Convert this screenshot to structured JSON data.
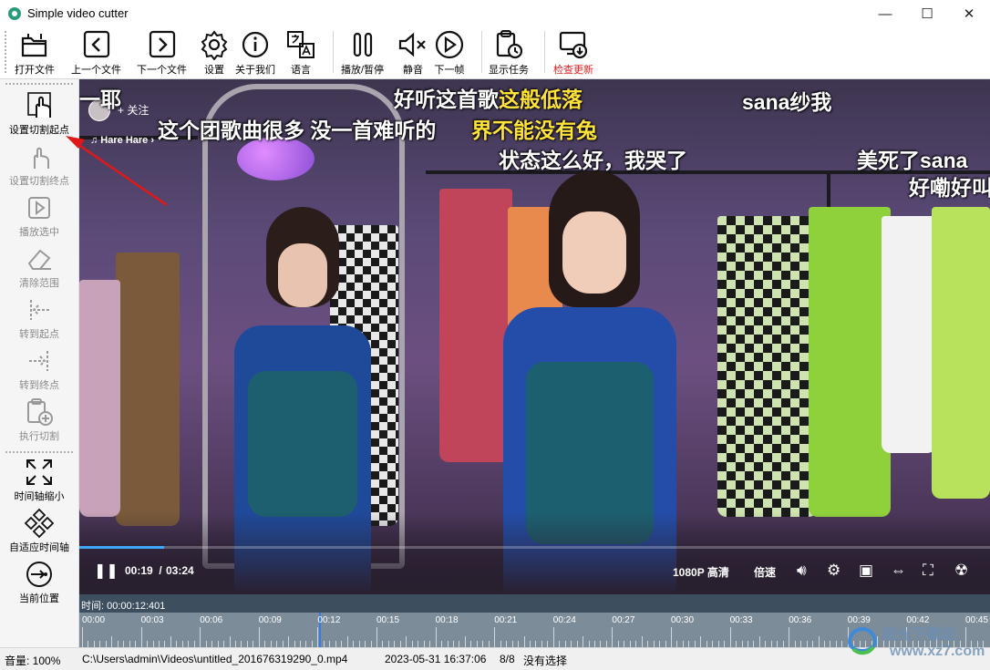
{
  "window": {
    "title": "Simple video cutter",
    "controls": [
      "—",
      "☐",
      "✕"
    ]
  },
  "toolbar": {
    "open": "打开文件",
    "prev": "上一个文件",
    "next": "下一个文件",
    "settings": "设置",
    "about": "关于我们",
    "language": "语言",
    "play_pause": "播放/暂停",
    "mute": "静音",
    "next_frame": "下一帧",
    "show_tasks": "显示任务",
    "check_update": "检查更新",
    "check_update_color": "#e02020"
  },
  "sidebar": {
    "set_start": "设置切割起点",
    "set_end": "设置切割终点",
    "play_selection": "播放选中",
    "clear_range": "清除范围",
    "goto_start": "转到起点",
    "goto_end": "转到终点",
    "do_cut": "执行切割",
    "zoom_timeline": "时间轴缩小",
    "fit_timeline": "自适应时间轴",
    "current_position": "当前位置"
  },
  "video": {
    "follow": "+ 关注",
    "music": "♫ Hare Hare ›",
    "danmu": [
      {
        "text": "一耶",
        "color": "white"
      },
      {
        "text": "好听这首歌",
        "color": "white"
      },
      {
        "text": "这般低落",
        "color": "yellow"
      },
      {
        "text": "sana纱我",
        "color": "white"
      },
      {
        "text": "这个团歌曲很多 没一首难听的",
        "color": "white"
      },
      {
        "text": "界不能没有兔",
        "color": "yellow"
      },
      {
        "text": "状态这么好，我哭了",
        "color": "white"
      },
      {
        "text": "美死了sana",
        "color": "white"
      },
      {
        "text": "好嘞好叫",
        "color": "white"
      }
    ],
    "time_current": "00:19",
    "time_sep": " / ",
    "time_total": "03:24",
    "progress": 0.093,
    "quality": "1080P 高清",
    "speed": "倍速"
  },
  "timeline": {
    "time_label": "时间:",
    "time_value": "00:00:12:401",
    "ticks": [
      "00:00",
      "00:03",
      "00:06",
      "00:09",
      "00:12",
      "00:15",
      "00:18",
      "00:21",
      "00:24",
      "00:27",
      "00:30",
      "00:33",
      "00:36",
      "00:39",
      "00:42",
      "00:45"
    ]
  },
  "status": {
    "volume": "音量: 100%",
    "path": "C:\\Users\\admin\\Videos\\untitled_201676319290_0.mp4",
    "datetime": "2023-05-31 16:37:06",
    "count": "8/8",
    "selection": "没有选择"
  },
  "watermark": {
    "main": "极光下载站",
    "url": "www.xz7.com"
  }
}
